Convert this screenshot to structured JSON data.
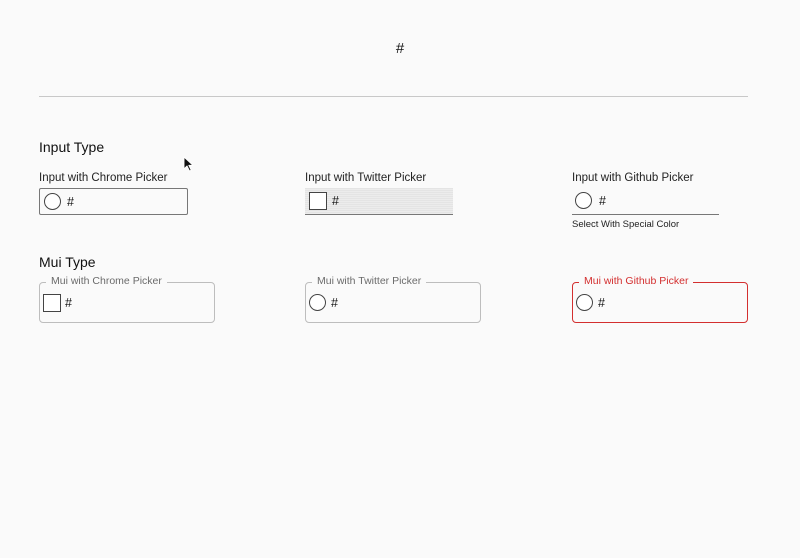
{
  "header": {
    "value": "#"
  },
  "input_section": {
    "title": "Input Type",
    "fields": [
      {
        "label": "Input with Chrome Picker",
        "value": "#"
      },
      {
        "label": "Input with Twitter Picker",
        "value": "#"
      },
      {
        "label": "Input with Github Picker",
        "value": "#",
        "helper": "Select With Special Color"
      }
    ]
  },
  "mui_section": {
    "title": "Mui Type",
    "fields": [
      {
        "label": "Mui with Chrome Picker",
        "value": "#"
      },
      {
        "label": "Mui with Twitter Picker",
        "value": "#"
      },
      {
        "label": "Mui with Github Picker",
        "value": "#",
        "state": "error"
      }
    ]
  },
  "colors": {
    "background": "#fafafa",
    "border": "#bdbdbd",
    "error": "#d32f2f"
  },
  "icons": {
    "swatch_circle": "color-swatch-circle-icon",
    "swatch_square": "color-swatch-square-icon",
    "cursor": "mouse-pointer-icon"
  }
}
